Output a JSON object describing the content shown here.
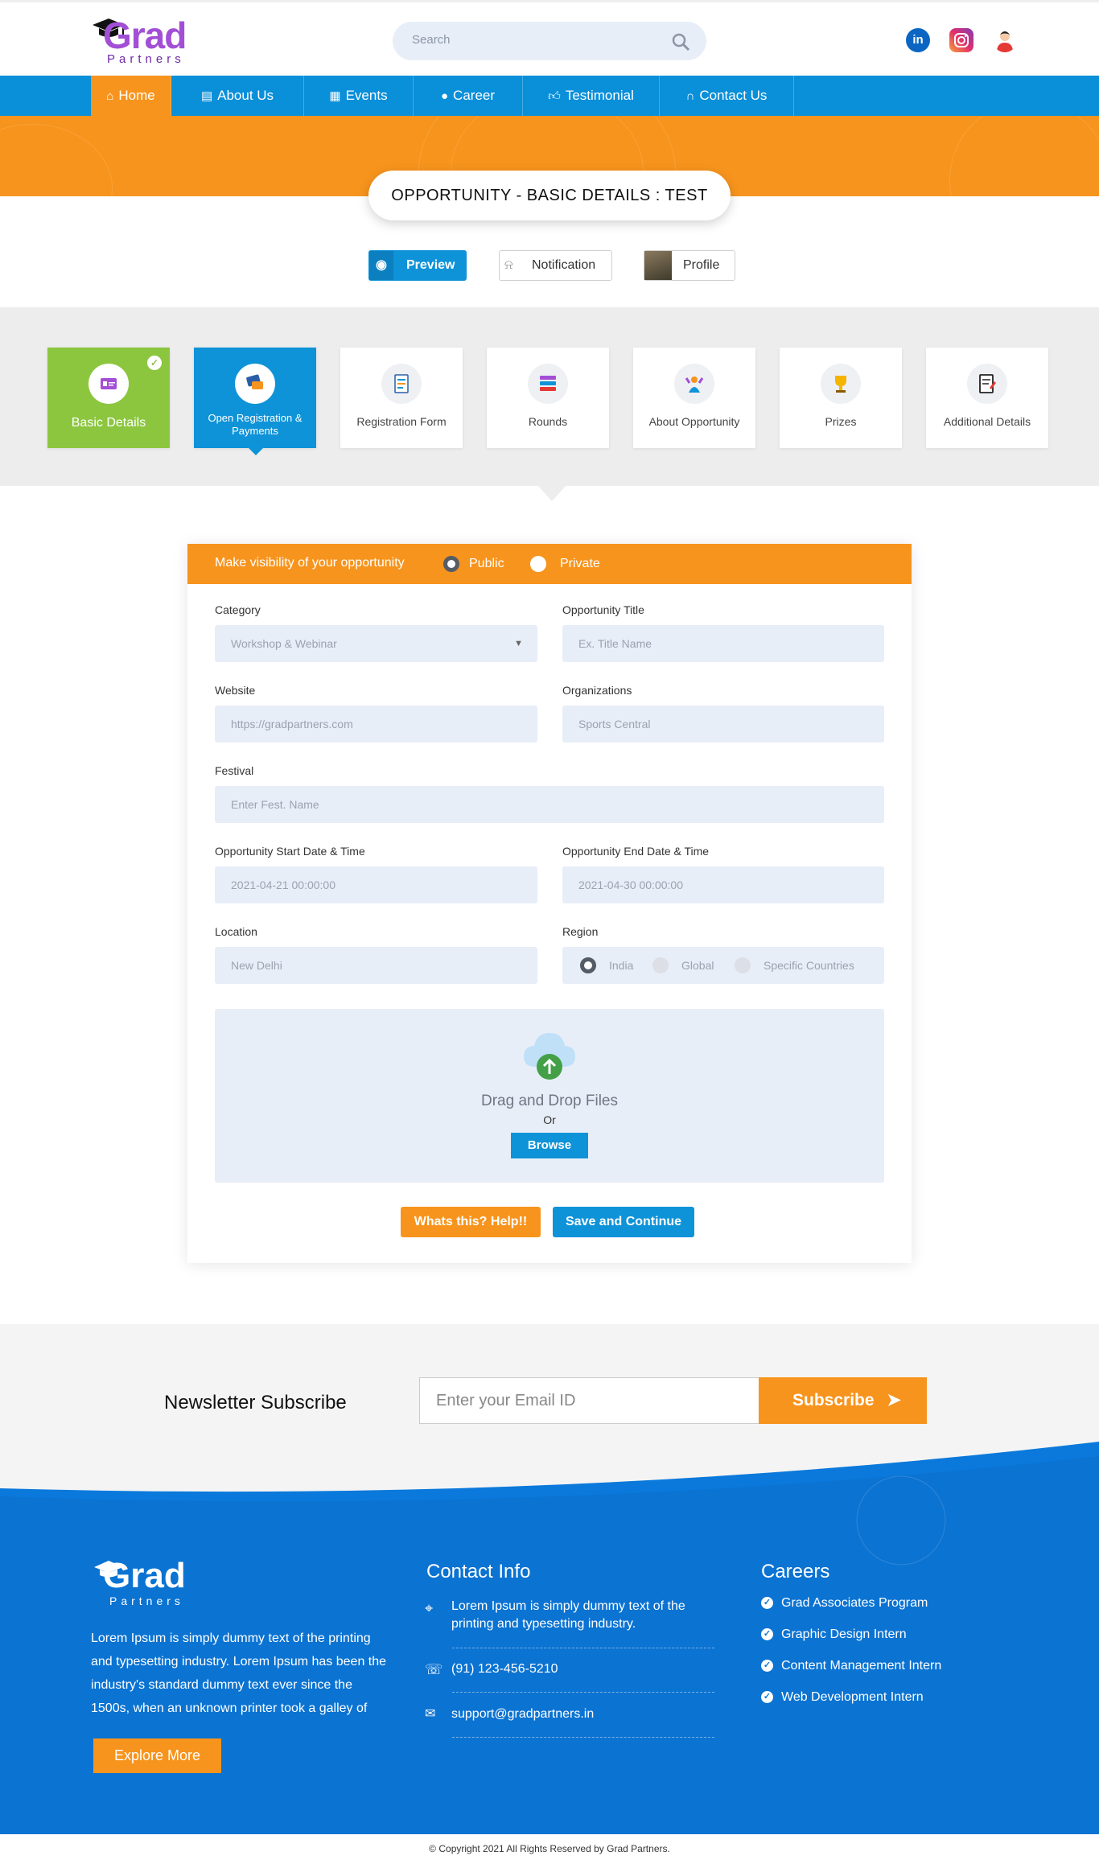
{
  "header": {
    "logo_main": "Grad",
    "logo_sub": "Partners",
    "search_placeholder": "Search",
    "social": {
      "linkedin": "in"
    }
  },
  "nav": {
    "items": [
      {
        "label": "Home",
        "icon": "home-icon"
      },
      {
        "label": "About Us",
        "icon": "id-card-icon"
      },
      {
        "label": "Events",
        "icon": "calendar-icon"
      },
      {
        "label": "Career",
        "icon": "user-icon"
      },
      {
        "label": "Testimonial",
        "icon": "thumbs-up-icon"
      },
      {
        "label": "Contact Us",
        "icon": "headphones-icon"
      }
    ]
  },
  "page_title": "OPPORTUNITY - BASIC DETAILS : TEST",
  "actions": {
    "preview": "Preview",
    "notification": "Notification",
    "profile": "Profile"
  },
  "steps": [
    {
      "label": "Basic Details",
      "state": "completed"
    },
    {
      "label": "Open Registration & Payments",
      "state": "active"
    },
    {
      "label": "Registration Form",
      "state": "pending"
    },
    {
      "label": "Rounds",
      "state": "pending"
    },
    {
      "label": "About Opportunity",
      "state": "pending"
    },
    {
      "label": "Prizes",
      "state": "pending"
    },
    {
      "label": "Additional Details",
      "state": "pending"
    }
  ],
  "form": {
    "visibility_label": "Make visibility of your opportunity",
    "visibility_options": [
      "Public",
      "Private"
    ],
    "visibility_selected": "Public",
    "category_label": "Category",
    "category_value": "Workshop & Webinar",
    "title_label": "Opportunity Title",
    "title_placeholder": "Ex. Title Name",
    "website_label": "Website",
    "website_value": "https://gradpartners.com",
    "org_label": "Organizations",
    "org_value": "Sports Central",
    "festival_label": "Festival",
    "festival_placeholder": "Enter Fest. Name",
    "start_label": "Opportunity Start Date & Time",
    "start_value": "2021-04-21 00:00:00",
    "end_label": "Opportunity End Date & Time",
    "end_value": "2021-04-30 00:00:00",
    "location_label": "Location",
    "location_value": "New Delhi",
    "region_label": "Region",
    "region_options": [
      "India",
      "Global",
      "Specific Countries"
    ],
    "region_selected": "India",
    "drop_text": "Drag and Drop Files",
    "or_text": "Or",
    "browse": "Browse",
    "help_button": "Whats this? Help!!",
    "save_button": "Save and Continue"
  },
  "newsletter": {
    "title": "Newsletter Subscribe",
    "placeholder": "Enter your Email ID",
    "button": "Subscribe"
  },
  "footer": {
    "about": "Lorem Ipsum is simply dummy text of the printing and typesetting industry. Lorem Ipsum has been the industry's standard dummy text ever since the 1500s, when an unknown printer took a galley of",
    "explore": "Explore More",
    "contact_title": "Contact Info",
    "address": "Lorem Ipsum is simply dummy text of the printing and typesetting industry.",
    "phone": "(91) 123-456-5210",
    "email": "support@gradpartners.in",
    "careers_title": "Careers",
    "careers": [
      "Grad Associates Program",
      "Graphic Design Intern",
      "Content Management Intern",
      "Web Development Intern"
    ],
    "copyright": "© Copyright 2021 All Rights Reserved by Grad Partners."
  },
  "colors": {
    "orange": "#f7941d",
    "blue": "#0a8fd9",
    "green": "#8cc63f"
  }
}
